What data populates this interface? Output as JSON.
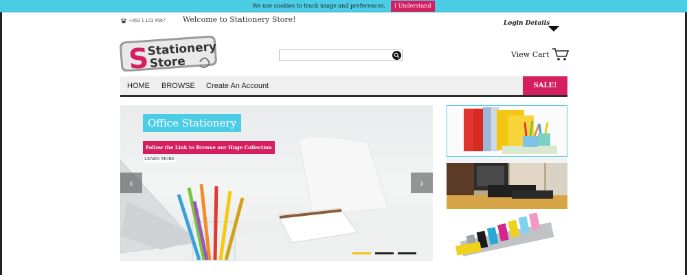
{
  "cookie": {
    "message": "We use cookies to track usage and preferences.",
    "button": "I Understand"
  },
  "header": {
    "phone": "+353 1 123 4567",
    "welcome": "Welcome to Stationery Store!",
    "login": "Login Details",
    "view_cart": "View Cart"
  },
  "logo": {
    "line1": "Stationery",
    "line2": "Store"
  },
  "search": {
    "value": "",
    "placeholder": ""
  },
  "nav": {
    "items": [
      "HOME",
      "BROWSE",
      "Create An Account"
    ],
    "sale": "SALE!"
  },
  "hero": {
    "title": "Office Stationery",
    "subtitle": "Follow the Link to Browse our Huge Collection",
    "more": "LEARN MORE",
    "slides": 3,
    "active_slide": 1
  },
  "colors": {
    "accent_cyan": "#4ccde6",
    "accent_pink": "#d61f5f",
    "nav_bg": "#efefef"
  },
  "icons": {
    "phone": "phone-icon",
    "search": "search-icon",
    "cart": "cart-icon",
    "dropdown": "chevron-down-icon",
    "prev": "chevron-left-icon",
    "next": "chevron-right-icon"
  }
}
